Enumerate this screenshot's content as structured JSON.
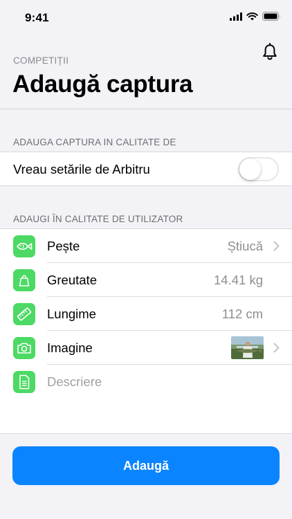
{
  "status_bar": {
    "time": "9:41"
  },
  "header": {
    "caption": "COMPETIȚII",
    "title": "Adaugă captura",
    "notifications_icon": "bell-icon"
  },
  "referee_section": {
    "label": "ADAUGA CAPTURA IN CALITATE DE",
    "toggle_label": "Vreau setările de Arbitru",
    "toggle_on": false
  },
  "user_section": {
    "label": "ADAUGI ÎN CALITATE DE UTILIZATOR",
    "rows": [
      {
        "icon": "fish-icon",
        "label": "Pește",
        "value": "Știucă",
        "chevron": true
      },
      {
        "icon": "weight-icon",
        "label": "Greutate",
        "value": "14.41 kg",
        "chevron": false
      },
      {
        "icon": "ruler-icon",
        "label": "Lungime",
        "value": "112 cm",
        "chevron": false
      },
      {
        "icon": "camera-icon",
        "label": "Imagine",
        "value": "",
        "chevron": true
      },
      {
        "icon": "document-icon",
        "label": "",
        "placeholder": "Descriere",
        "chevron": false
      }
    ]
  },
  "colors": {
    "accent": "#0a84ff",
    "icon_bg": "#4cd964",
    "background": "#f2f2f7"
  },
  "action": {
    "add_label": "Adaugă"
  }
}
